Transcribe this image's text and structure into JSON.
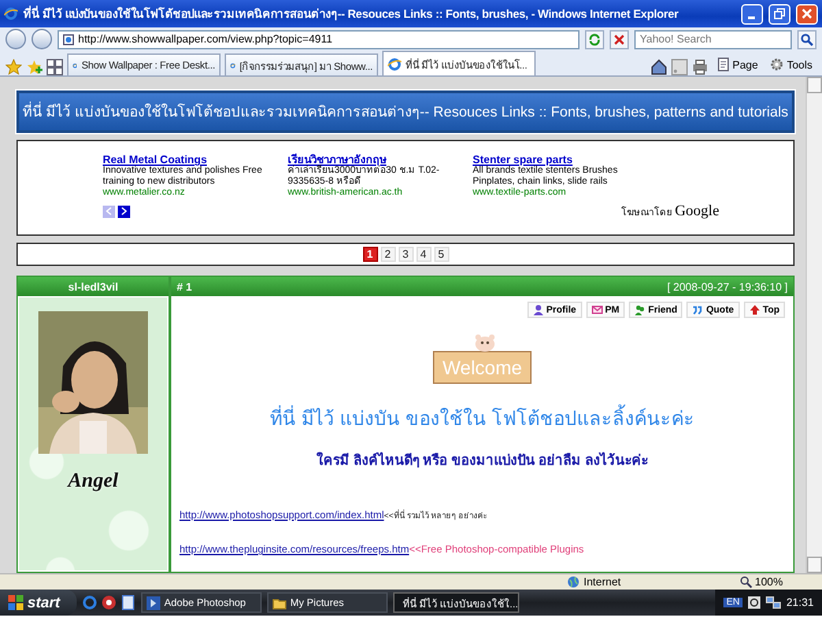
{
  "window": {
    "title": "ที่นี่ มีไว้ แบ่งบันของใช้ในโฟโต้ชอปและรวมเทคนิคการสอนต่างๆ-- Resouces Links :: Fonts, brushes, - Windows Internet Explorer"
  },
  "address": {
    "url": "http://www.showwallpaper.com/view.php?topic=4911"
  },
  "search": {
    "placeholder": "Yahoo! Search"
  },
  "tabs": [
    {
      "label": "Show Wallpaper : Free Deskt...",
      "selected": false
    },
    {
      "label": "[กิจกรรมร่วมสนุก] มา Showw...",
      "selected": false
    },
    {
      "label": "ที่นี่ มีไว้ แบ่งบันของใช้ในโ...",
      "selected": true
    }
  ],
  "command_bar": [
    "Page",
    "Tools"
  ],
  "page": {
    "banner": "ที่นี่ มีไว้ แบ่งบันของใช้ในโฟโต้ชอปและรวมเทคนิคการสอนต่างๆ-- Resouces Links :: Fonts, brushes, patterns and tutorials",
    "ads": [
      {
        "title": "Real Metal Coatings",
        "text": "Innovative textures and polishes Free training to new distributors",
        "url": "www.metalier.co.nz"
      },
      {
        "title": "เรียนวิชาภาษาอังกฤษ",
        "text": "ค่าเล่าเรียน3000บาทต่อ30 ช.ม T.02-9335635-8 หรือดี",
        "url": "www.british-american.ac.th"
      },
      {
        "title": "Stenter spare parts",
        "text": "All brands textile stenters Brushes Pinplates, chain links, slide rails",
        "url": "www.textile-parts.com"
      }
    ],
    "ads_attribution": "โฆษณาโดย",
    "ads_brand": "Google",
    "pages": [
      {
        "label": "1",
        "selected": true
      },
      {
        "label": "2",
        "selected": false
      },
      {
        "label": "3",
        "selected": false
      },
      {
        "label": "4",
        "selected": false
      },
      {
        "label": "5",
        "selected": false
      }
    ],
    "post": {
      "author": "sl-ledl3vil",
      "badge": "Angel",
      "number": "# 1",
      "date": "[ 2008-09-27 - 19:36:10 ]",
      "actions": [
        "Profile",
        "PM",
        "Friend",
        "Quote",
        "Top"
      ],
      "sign": "Welcome",
      "heading": "ที่นี่ มีไว้ แบ่งบัน ของใช้ใน โฟโต้ชอปและลิ้งค์นะค่ะ",
      "subheading": "ใครมี ลิงค์ไหนดีๆ หรือ ของมาแบ่งปัน อย่าลืม ลงไว้นะค่ะ",
      "links": [
        {
          "url": "http://www.photoshopsupport.com/index.html",
          "note": "<<ที่นี่ รวมไว้ หลายๆ อย่างค่ะ",
          "kind": "small"
        },
        {
          "url": "http://www.thepluginsite.com/resources/freeps.htm",
          "note": "<<Free Photoshop-compatible Plugins",
          "kind": "highlight"
        }
      ]
    }
  },
  "status_bar": {
    "zone": "Internet",
    "zoom": "100%"
  },
  "taskbar": {
    "start": "start",
    "buttons": [
      {
        "label": "Adobe Photoshop",
        "selected": false
      },
      {
        "label": "My Pictures",
        "selected": false
      },
      {
        "label": "ที่นี่ มีไว้ แบ่งบันของใช้ใ...",
        "selected": true
      }
    ],
    "language": "EN",
    "clock": "21:31"
  }
}
